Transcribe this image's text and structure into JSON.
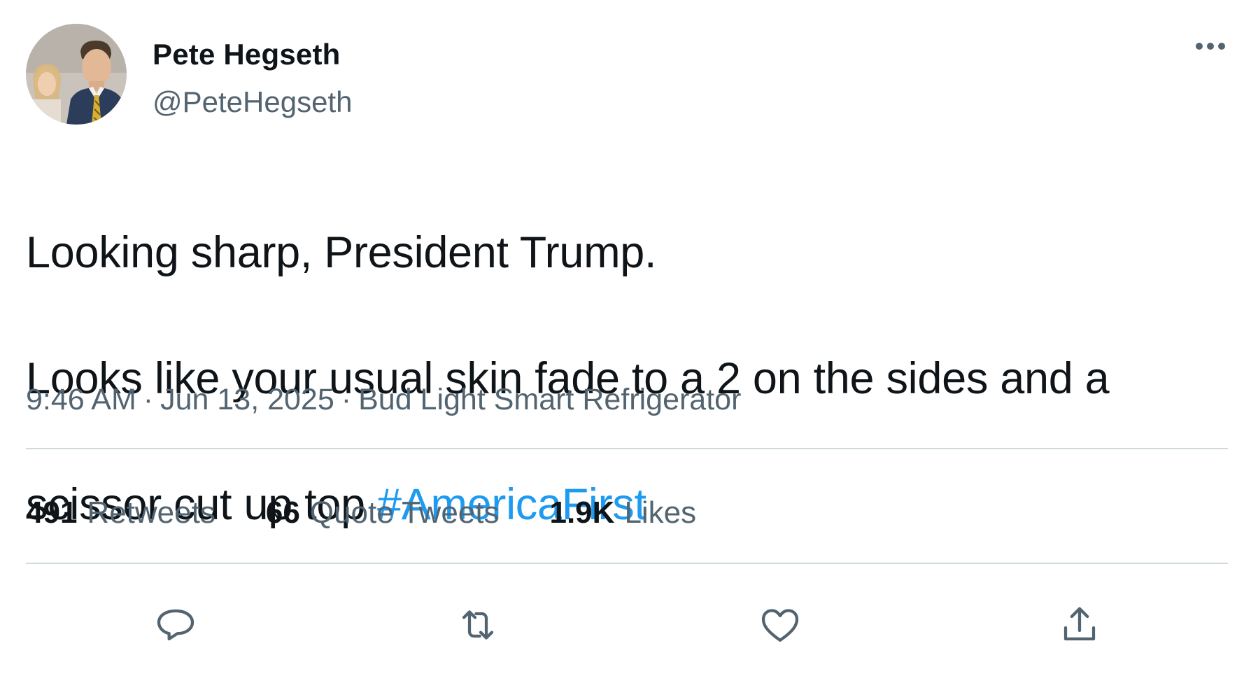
{
  "author": {
    "display_name": "Pete Hegseth",
    "handle": "@PeteHegseth",
    "avatar_icon": "profile-photo"
  },
  "tweet": {
    "text_line1": "Looking sharp, President Trump.",
    "text_line2": "Looks like your usual skin fade to a 2 on the sides and a",
    "text_line3_prefix": "scissor cut up top ",
    "hashtag": "#AmericaFirst"
  },
  "meta": {
    "time": "9:46 AM",
    "separator": "·",
    "date": "Jun 13, 2025",
    "source": "Bud Light Smart Refrigerator"
  },
  "stats": {
    "retweets_count": "491",
    "retweets_label": "Retweets",
    "quotes_count": "66",
    "quotes_label": "Quote Tweets",
    "likes_count": "1.9K",
    "likes_label": "Likes"
  },
  "actions": {
    "reply_icon": "reply-icon",
    "retweet_icon": "retweet-icon",
    "like_icon": "heart-icon",
    "share_icon": "share-icon",
    "more_icon": "more-icon"
  },
  "colors": {
    "text": "#0f1419",
    "secondary": "#536471",
    "link": "#1d9bf0",
    "divider": "#cfd9de"
  }
}
